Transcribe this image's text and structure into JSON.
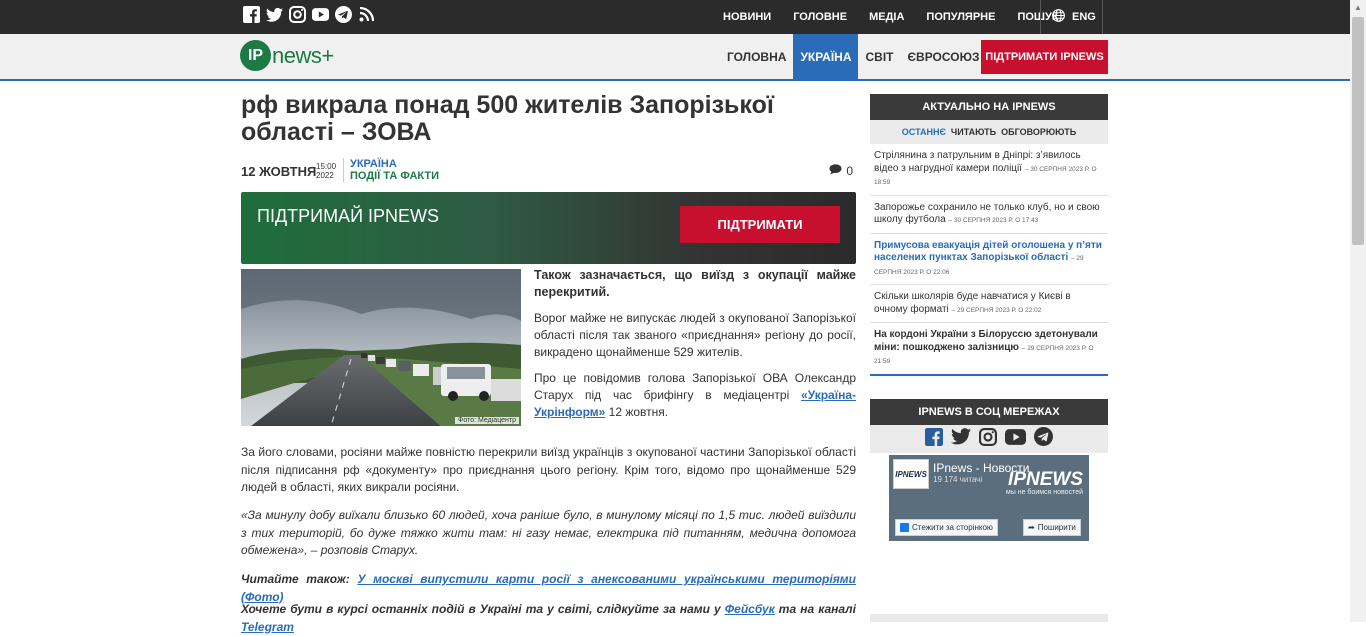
{
  "topbar": {
    "nav": [
      "НОВИНИ",
      "ГОЛОВНЕ",
      "МЕДІА",
      "ПОПУЛЯРНЕ",
      "ПОШУК"
    ],
    "lang": "ENG"
  },
  "mainnav": {
    "logo_ip": "IP",
    "logo_rest": "news+",
    "items": [
      "ГОЛОВНА",
      "УКРАЇНА",
      "СВІТ",
      "ЄВРОСОЮЗ"
    ],
    "active": "УКРАЇНА",
    "support": "ПІДТРИМАТИ IPNEWS"
  },
  "article": {
    "title": "рф викрала понад 500 жителів Запорізької області – ЗОВА",
    "date": "12 ЖОВТНЯ",
    "time": "15:00",
    "year": "2022",
    "category1": "УКРАЇНА",
    "category2": "ПОДІЇ ТА ФАКТИ",
    "comments": "0",
    "banner_text": "ПІДТРИМАЙ IPNEWS",
    "banner_button": "ПІДТРИМАТИ",
    "photo_credit": "Фото: Медіацентр",
    "lead": "Також зазначається, що виїзд з окупації майже перекритий.",
    "p_a": "Ворог майже не випускає людей з окупованої Запорізької області після так званого «приєднання» регіону до росії, викрадено щонайменше 529 жителів.",
    "p_b_pre": "Про це повідомив голова Запорізької ОВА Олександр Старух під час брифінгу в медіацентрі ",
    "p_b_link": "«Україна-Укрінформ»",
    "p_b_post": " 12 жовтня.",
    "p1": "За його словами, росіяни майже повністю перекрили виїзд українців з окупованої частини Запорізької області після підписання рф «документу» про приєднання цього регіону. Крім того, відомо про щонайменше 529 людей в області, яких викрали росіяни.",
    "p2": "«За минулу добу виїхали близько 60 людей, хоча раніше було, в минулому місяці по 1,5 тис. людей виїздили з тих територій, бо дуже тяжко жити там: ні газу немає, електрика під питанням, медична допомога обмежена», – розповів Старух.",
    "read_also_label": "Читайте також:",
    "read_also_link": "У москві випустили карти росії з анексованими українськими територіями (Фото)",
    "follow_pre": "Хочете бути в курсі останніх подій в Україні та у світі, слідкуйте за нами у ",
    "follow_fb": "Фейсбук",
    "follow_mid": " та на каналі ",
    "follow_tg": "Telegram"
  },
  "sidebar": {
    "title": "АКТУАЛЬНО НА IPNEWS",
    "tabs": [
      "ОСТАННЄ",
      "ЧИТАЮТЬ",
      "ОБГОВОРЮЮТЬ"
    ],
    "news": [
      {
        "title": "Стрілянина з патрульним в Дніпрі: з’явилось відео з нагрудної камери поліції",
        "date": "30 СЕРПНЯ 2023 Р. О 18:59"
      },
      {
        "title": "Запорожье сохранило не только клуб, но и свою школу футбола",
        "date": "30 СЕРПНЯ 2023 Р. О 17:43"
      },
      {
        "title": "Примусова евакуація дітей оголошена у п’яти населених пунктах Запорізької області",
        "date": "29 СЕРПНЯ 2023 Р. О 22:06"
      },
      {
        "title": "Скільки школярів буде навчатися у Києві в очному форматі",
        "date": "29 СЕРПНЯ 2023 Р. О 22:02"
      },
      {
        "title": "На кордоні України з Білоруссю здетонували міни: пошкоджено залізницю",
        "date": "29 СЕРПНЯ 2023 Р. О 21:59"
      }
    ],
    "social_title": "IPNEWS В СОЦ МЕРЕЖАХ",
    "fb_logo": "IPNEWS",
    "fb_name": "IPnews - Новости",
    "fb_count": "19 174 читачі",
    "fb_brand": "IPNEWS",
    "fb_tag": "мы не боимся новостей",
    "fb_follow": "Стежити за сторінкою",
    "fb_share": "Поширити"
  },
  "colors": {
    "accent": "#2a6cb8",
    "brand_green": "#1e7a44",
    "support_red": "#c8102e",
    "dark": "#2b2b2b"
  },
  "icons": [
    "facebook-icon",
    "twitter-icon",
    "instagram-icon",
    "youtube-icon",
    "telegram-icon",
    "rss-icon",
    "globe-icon",
    "comment-icon"
  ]
}
